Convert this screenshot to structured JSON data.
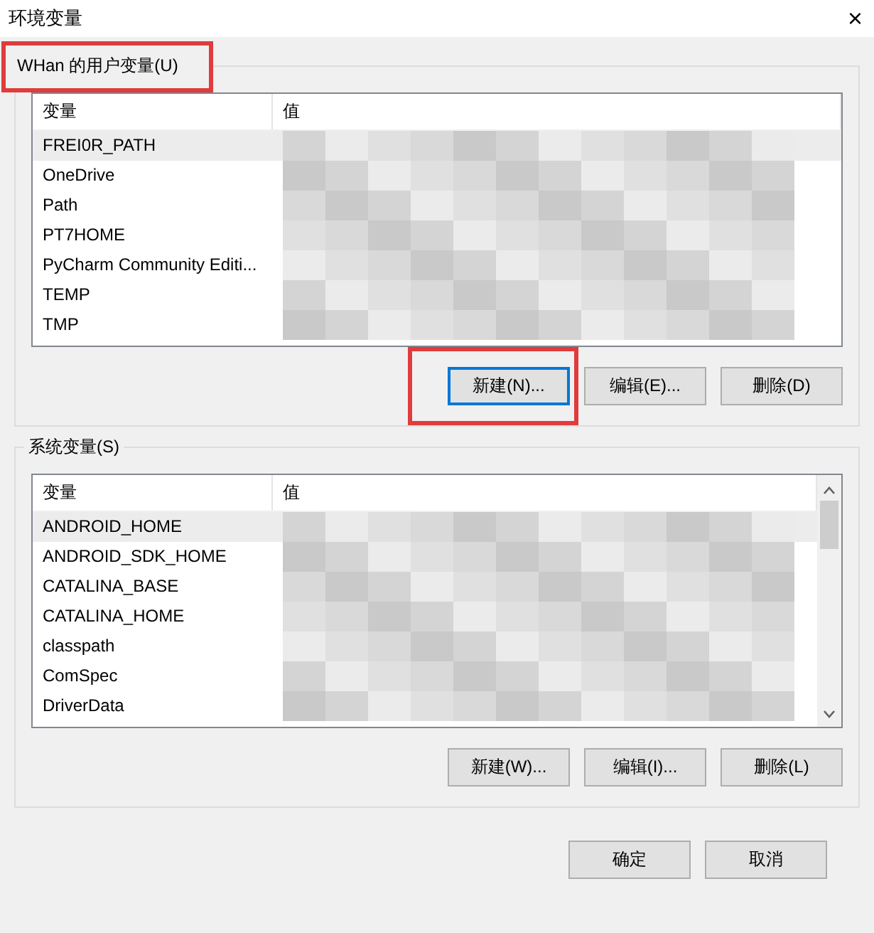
{
  "window": {
    "title": "环境变量",
    "close": "×"
  },
  "groups": [
    {
      "title": "WHan 的用户变量(U)",
      "highlighted": true,
      "columns": [
        "变量",
        "值"
      ],
      "scrollbar": false,
      "rows": [
        {
          "name": "FREI0R_PATH",
          "selected": true
        },
        {
          "name": "OneDrive",
          "selected": false
        },
        {
          "name": "Path",
          "selected": false
        },
        {
          "name": "PT7HOME",
          "selected": false
        },
        {
          "name": "PyCharm Community Editi...",
          "selected": false
        },
        {
          "name": "TEMP",
          "selected": false
        },
        {
          "name": "TMP",
          "selected": false
        }
      ],
      "buttons": [
        {
          "label": "新建(N)...",
          "focused": true,
          "highlighted": true
        },
        {
          "label": "编辑(E)...",
          "focused": false,
          "highlighted": false
        },
        {
          "label": "删除(D)",
          "focused": false,
          "highlighted": false
        }
      ]
    },
    {
      "title": "系统变量(S)",
      "highlighted": false,
      "columns": [
        "变量",
        "值"
      ],
      "scrollbar": true,
      "rows": [
        {
          "name": "ANDROID_HOME",
          "selected": true
        },
        {
          "name": "ANDROID_SDK_HOME",
          "selected": false
        },
        {
          "name": "CATALINA_BASE",
          "selected": false
        },
        {
          "name": "CATALINA_HOME",
          "selected": false
        },
        {
          "name": "classpath",
          "selected": false
        },
        {
          "name": "ComSpec",
          "selected": false
        },
        {
          "name": "DriverData",
          "selected": false
        }
      ],
      "buttons": [
        {
          "label": "新建(W)...",
          "focused": false,
          "highlighted": false
        },
        {
          "label": "编辑(I)...",
          "focused": false,
          "highlighted": false
        },
        {
          "label": "删除(L)",
          "focused": false,
          "highlighted": false
        }
      ]
    }
  ],
  "footer_buttons": [
    {
      "label": "确定"
    },
    {
      "label": "取消"
    }
  ]
}
